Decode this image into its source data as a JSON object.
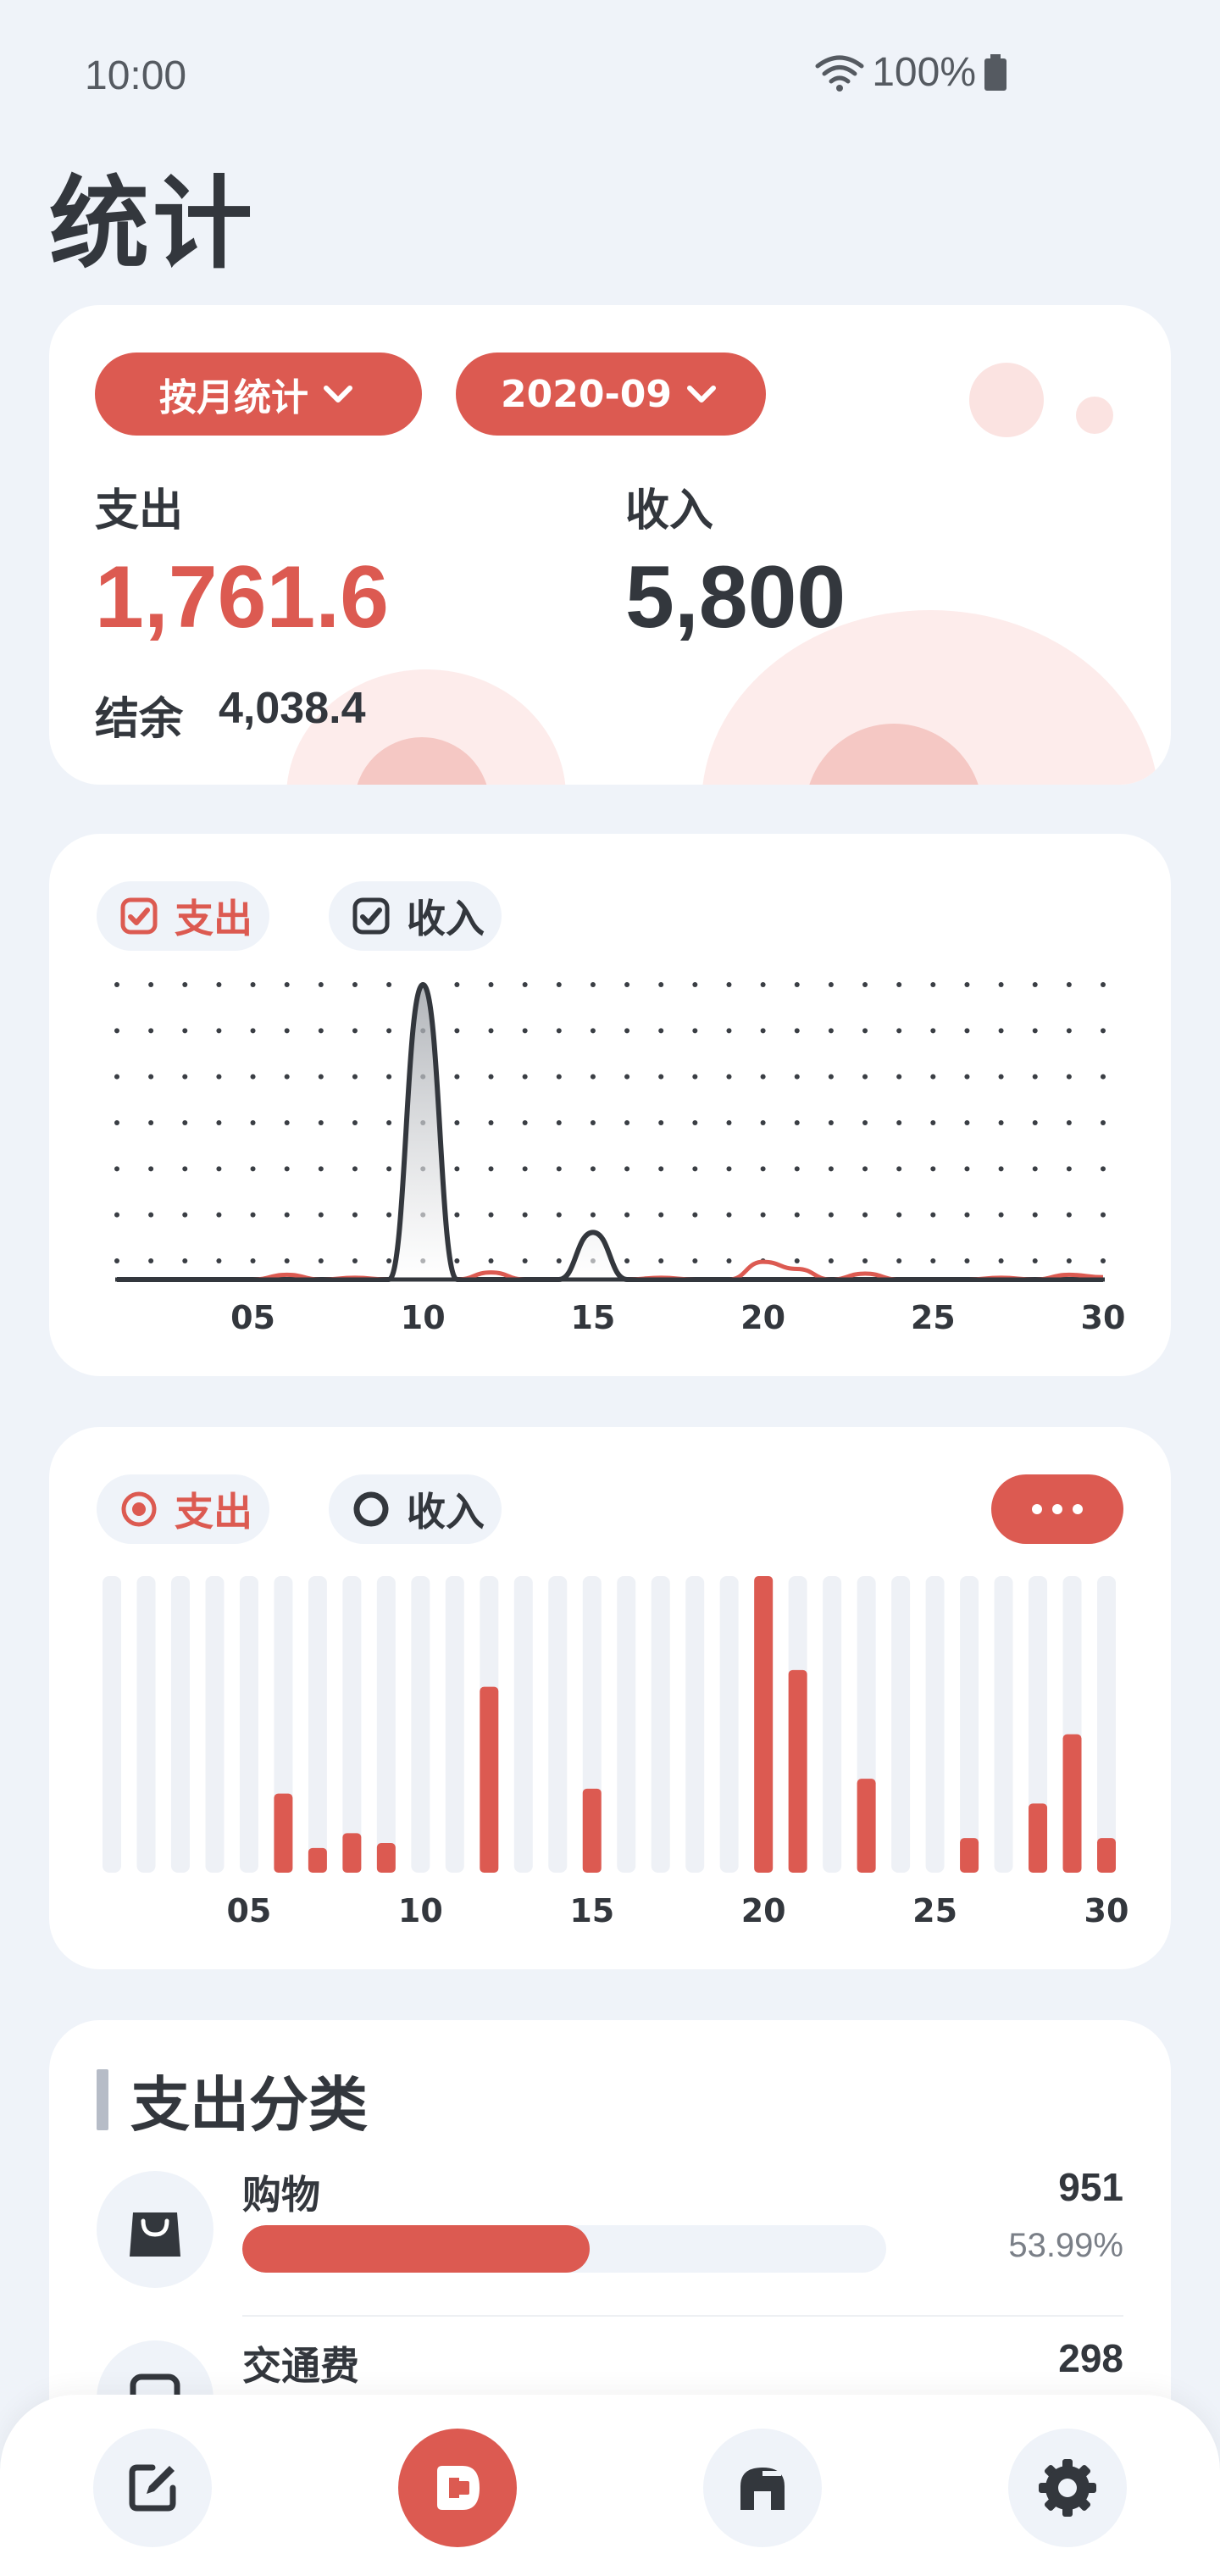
{
  "status": {
    "time": "10:00",
    "battery": "100%"
  },
  "page": {
    "title": "统计"
  },
  "summary": {
    "mode_label": "按月统计",
    "month_label": "2020-09",
    "expense_label": "支出",
    "expense_value": "1,761.6",
    "income_label": "收入",
    "income_value": "5,800",
    "balance_label": "结余",
    "balance_value": "4,038.4"
  },
  "colors": {
    "accent": "#dc5a51",
    "text": "#33373d",
    "bg": "#eff3f9",
    "muted_bar": "#eef1f6"
  },
  "line_card": {
    "legend": [
      {
        "label": "支出",
        "checked": true,
        "color": "#dc5a51"
      },
      {
        "label": "收入",
        "checked": true,
        "color": "#33373d"
      }
    ]
  },
  "bar_card": {
    "legend": [
      {
        "label": "支出",
        "selected": true,
        "color": "#dc5a51"
      },
      {
        "label": "收入",
        "selected": false,
        "color": "#33373d"
      }
    ]
  },
  "chart_data": [
    {
      "type": "area",
      "x": [
        1,
        2,
        3,
        4,
        5,
        6,
        7,
        8,
        9,
        10,
        11,
        12,
        13,
        14,
        15,
        16,
        17,
        18,
        19,
        20,
        21,
        22,
        23,
        24,
        25,
        26,
        27,
        28,
        29,
        30
      ],
      "xticks": [
        "05",
        "10",
        "15",
        "20",
        "25",
        "30"
      ],
      "xtick_values": [
        5,
        10,
        15,
        20,
        25,
        30
      ],
      "grid": "dots",
      "ylim": [
        0,
        5000
      ],
      "series": [
        {
          "name": "收入",
          "color": "#33373d",
          "values": [
            0,
            0,
            0,
            0,
            0,
            0,
            0,
            0,
            0,
            5000,
            0,
            0,
            0,
            0,
            800,
            0,
            0,
            0,
            0,
            0,
            0,
            0,
            0,
            0,
            0,
            0,
            0,
            0,
            0,
            0
          ]
        },
        {
          "name": "支出",
          "color": "#dc5a51",
          "values": [
            0,
            0,
            0,
            0,
            0,
            80,
            0,
            30,
            0,
            0,
            0,
            120,
            0,
            0,
            0,
            0,
            30,
            0,
            0,
            300,
            180,
            0,
            100,
            0,
            0,
            0,
            30,
            0,
            80,
            40
          ]
        }
      ]
    },
    {
      "type": "bar",
      "x": [
        1,
        2,
        3,
        4,
        5,
        6,
        7,
        8,
        9,
        10,
        11,
        12,
        13,
        14,
        15,
        16,
        17,
        18,
        19,
        20,
        21,
        22,
        23,
        24,
        25,
        26,
        27,
        28,
        29,
        30
      ],
      "xticks": [
        "05",
        "10",
        "15",
        "20",
        "25",
        "30"
      ],
      "xtick_values": [
        5,
        10,
        15,
        20,
        25,
        30
      ],
      "ylim": [
        0,
        300
      ],
      "series": [
        {
          "name": "支出",
          "color": "#dc5a51",
          "values": [
            0,
            0,
            0,
            0,
            0,
            80,
            25,
            40,
            30,
            0,
            0,
            188,
            0,
            0,
            85,
            0,
            0,
            0,
            0,
            300,
            205,
            0,
            95,
            0,
            0,
            35,
            0,
            70,
            140,
            35
          ]
        }
      ]
    }
  ],
  "categories": {
    "title": "支出分类",
    "items": [
      {
        "name": "购物",
        "amount": "951",
        "percent": "53.99%",
        "ratio": 0.5399
      },
      {
        "name": "交通费",
        "amount": "298"
      }
    ]
  }
}
